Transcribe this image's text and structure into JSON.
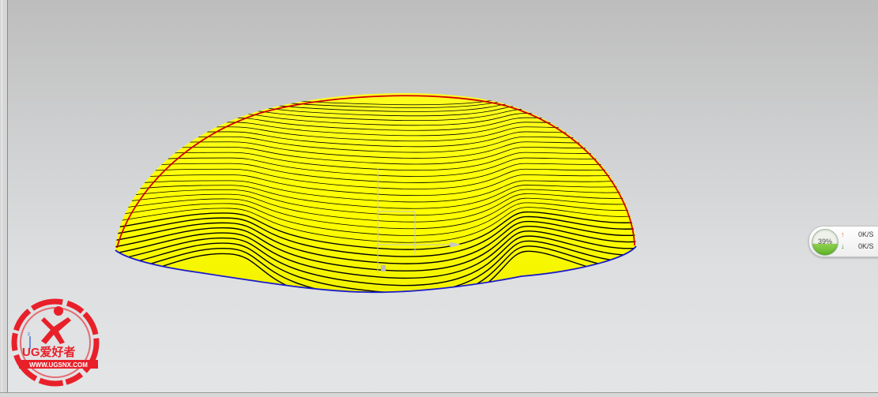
{
  "network_widget": {
    "percent": "39%",
    "upload_arrow": "↑",
    "upload_speed": "0K/S",
    "download_arrow": "↓",
    "download_speed": "0K/S",
    "fill_level_percent": 39
  },
  "logo": {
    "brand": "UG爱好者",
    "url": "WWW.UGSNX.COM",
    "color": "#e8202a"
  },
  "model": {
    "surface_color": "#ffff00",
    "top_edge_color": "#d00000",
    "bottom_edge_color": "#1a1acc",
    "contour_color": "#000000"
  },
  "icons": [
    "triad-icon",
    "network-ball-icon",
    "arrow-up-icon",
    "arrow-down-icon",
    "ug-logo-icon"
  ]
}
